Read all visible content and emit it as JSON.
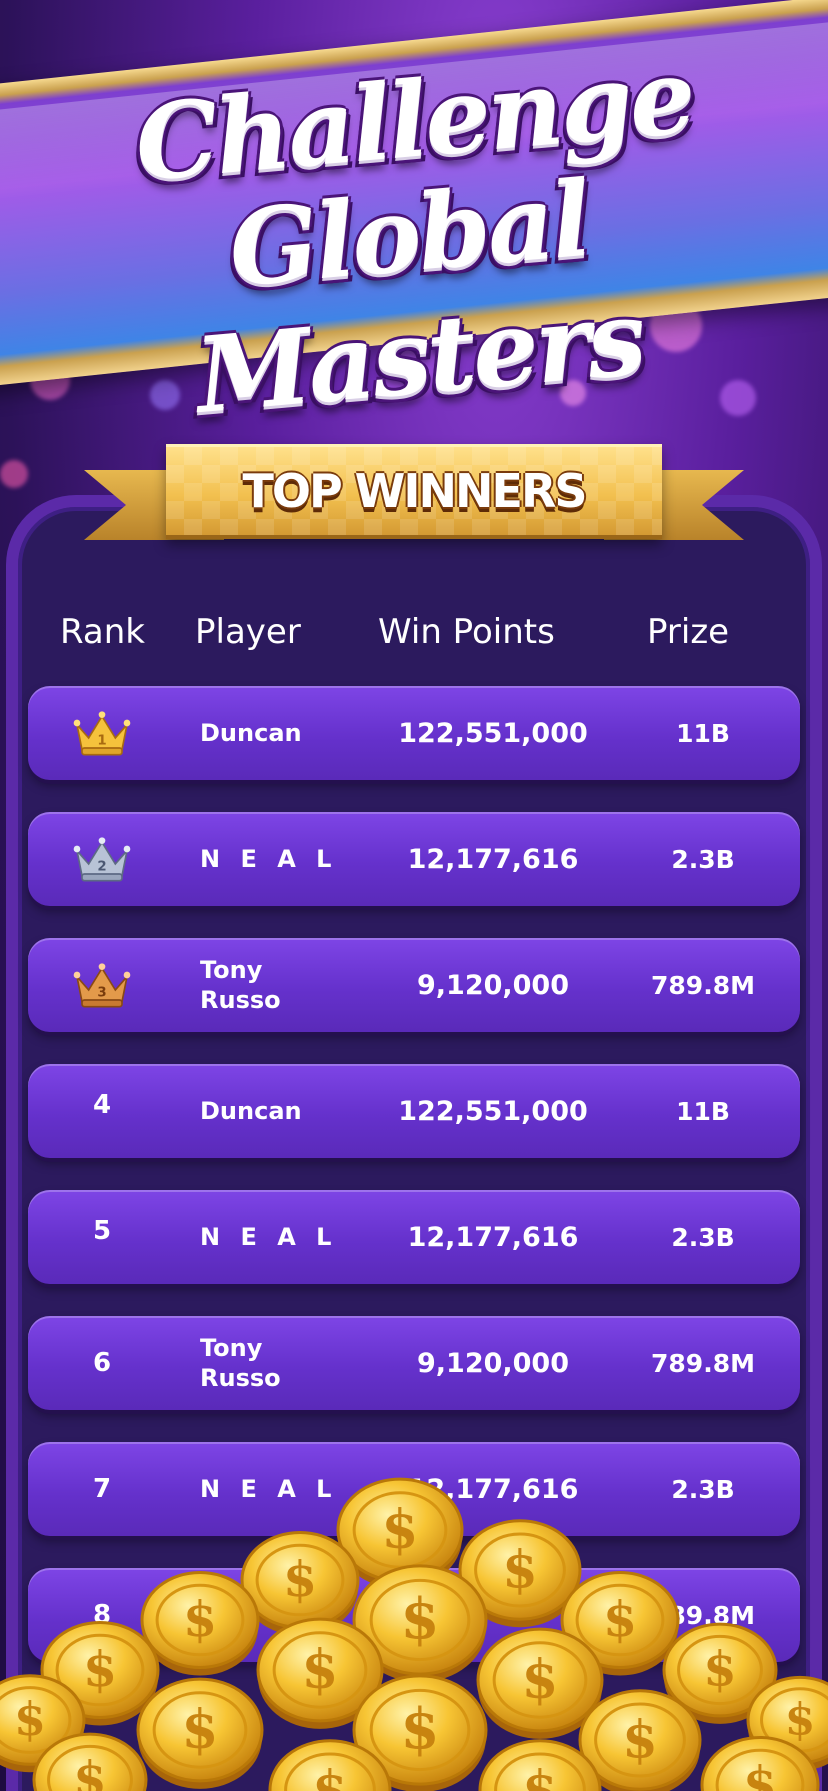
{
  "banner": {
    "title_line1": "Challenge",
    "title_line2": "Global Masters"
  },
  "ribbon": {
    "label": "TOP WINNERS"
  },
  "table": {
    "headers": {
      "rank": "Rank",
      "player": "Player",
      "points": "Win Points",
      "prize": "Prize"
    },
    "rows": [
      {
        "rank": "1",
        "rank_icon": "gold-crown-icon",
        "player": "Duncan",
        "points": "122,551,000",
        "prize": "11B"
      },
      {
        "rank": "2",
        "rank_icon": "silver-crown-icon",
        "player": "N E A L",
        "points": "12,177,616",
        "prize": "2.3B"
      },
      {
        "rank": "3",
        "rank_icon": "bronze-crown-icon",
        "player": "Tony Russo",
        "points": "9,120,000",
        "prize": "789.8M"
      },
      {
        "rank": "4",
        "player": "Duncan",
        "points": "122,551,000",
        "prize": "11B"
      },
      {
        "rank": "5",
        "player": "N E A L",
        "points": "12,177,616",
        "prize": "2.3B"
      },
      {
        "rank": "6",
        "player": "Tony Russo",
        "points": "9,120,000",
        "prize": "789.8M"
      },
      {
        "rank": "7",
        "player": "N E A L",
        "points": "12,177,616",
        "prize": "2.3B"
      },
      {
        "rank": "8",
        "player": "",
        "points": "",
        "prize": "789.8M"
      }
    ]
  },
  "colors": {
    "panel": "#2c1a5e",
    "row": "#6531cc",
    "ribbon": "#f2c04f",
    "gold": "#f5c23c",
    "silver": "#b8c3d6",
    "bronze": "#e39a4a"
  },
  "icons": {
    "coin": "gold-dollar-coin-icon"
  }
}
